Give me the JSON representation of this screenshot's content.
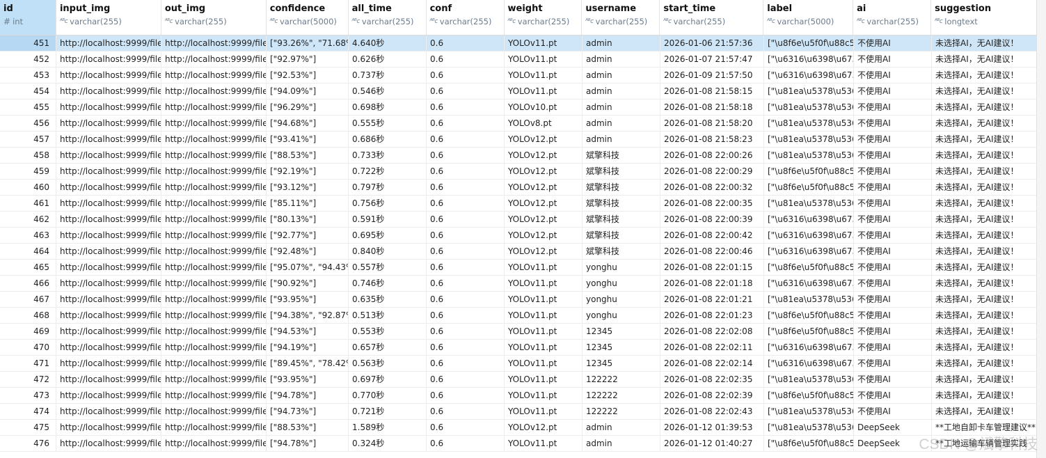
{
  "columns": [
    {
      "name": "id",
      "type": "int",
      "kind": "num"
    },
    {
      "name": "input_img",
      "type": "varchar(255)",
      "kind": "text"
    },
    {
      "name": "out_img",
      "type": "varchar(255)",
      "kind": "text"
    },
    {
      "name": "confidence",
      "type": "varchar(5000)",
      "kind": "text"
    },
    {
      "name": "all_time",
      "type": "varchar(255)",
      "kind": "text"
    },
    {
      "name": "conf",
      "type": "varchar(255)",
      "kind": "text"
    },
    {
      "name": "weight",
      "type": "varchar(255)",
      "kind": "text"
    },
    {
      "name": "username",
      "type": "varchar(255)",
      "kind": "text"
    },
    {
      "name": "start_time",
      "type": "varchar(255)",
      "kind": "text"
    },
    {
      "name": "label",
      "type": "varchar(5000)",
      "kind": "text"
    },
    {
      "name": "ai",
      "type": "varchar(255)",
      "kind": "text"
    },
    {
      "name": "suggestion",
      "type": "longtext",
      "kind": "text"
    }
  ],
  "type_prefix": "ᴬᴮc",
  "rows": [
    [
      "451",
      "http://localhost:9999/file",
      "http://localhost:9999/file",
      "[\"93.26%\", \"71.68%",
      "4.640秒",
      "0.6",
      "YOLOv11.pt",
      "admin",
      "2026-01-06 21:57:36",
      "[\"\\u8f6e\\u5f0f\\u88c5",
      "不使用AI",
      "未选择AI，无AI建议！"
    ],
    [
      "452",
      "http://localhost:9999/file",
      "http://localhost:9999/file",
      "[\"92.97%\"]",
      "0.626秒",
      "0.6",
      "YOLOv11.pt",
      "admin",
      "2026-01-07 21:57:47",
      "[\"\\u6316\\u6398\\u673",
      "不使用AI",
      "未选择AI，无AI建议！"
    ],
    [
      "453",
      "http://localhost:9999/file",
      "http://localhost:9999/file",
      "[\"92.53%\"]",
      "0.737秒",
      "0.6",
      "YOLOv11.pt",
      "admin",
      "2026-01-09 21:57:50",
      "[\"\\u6316\\u6398\\u673",
      "不使用AI",
      "未选择AI，无AI建议！"
    ],
    [
      "454",
      "http://localhost:9999/file",
      "http://localhost:9999/file",
      "[\"94.09%\"]",
      "0.546秒",
      "0.6",
      "YOLOv11.pt",
      "admin",
      "2026-01-08 21:58:15",
      "[\"\\u81ea\\u5378\\u536",
      "不使用AI",
      "未选择AI，无AI建议！"
    ],
    [
      "455",
      "http://localhost:9999/file",
      "http://localhost:9999/file",
      "[\"96.29%\"]",
      "0.698秒",
      "0.6",
      "YOLOv10.pt",
      "admin",
      "2026-01-08 21:58:18",
      "[\"\\u81ea\\u5378\\u536",
      "不使用AI",
      "未选择AI，无AI建议！"
    ],
    [
      "456",
      "http://localhost:9999/file",
      "http://localhost:9999/file",
      "[\"94.68%\"]",
      "0.555秒",
      "0.6",
      "YOLOv8.pt",
      "admin",
      "2026-01-08 21:58:20",
      "[\"\\u81ea\\u5378\\u536",
      "不使用AI",
      "未选择AI，无AI建议！"
    ],
    [
      "457",
      "http://localhost:9999/file",
      "http://localhost:9999/file",
      "[\"93.41%\"]",
      "0.686秒",
      "0.6",
      "YOLOv12.pt",
      "admin",
      "2026-01-08 21:58:23",
      "[\"\\u81ea\\u5378\\u536",
      "不使用AI",
      "未选择AI，无AI建议！"
    ],
    [
      "458",
      "http://localhost:9999/file",
      "http://localhost:9999/file",
      "[\"88.53%\"]",
      "0.733秒",
      "0.6",
      "YOLOv12.pt",
      "斌擎科技",
      "2026-01-08 22:00:26",
      "[\"\\u81ea\\u5378\\u536",
      "不使用AI",
      "未选择AI，无AI建议！"
    ],
    [
      "459",
      "http://localhost:9999/file",
      "http://localhost:9999/file",
      "[\"92.19%\"]",
      "0.722秒",
      "0.6",
      "YOLOv12.pt",
      "斌擎科技",
      "2026-01-08 22:00:29",
      "[\"\\u8f6e\\u5f0f\\u88c5",
      "不使用AI",
      "未选择AI，无AI建议！"
    ],
    [
      "460",
      "http://localhost:9999/file",
      "http://localhost:9999/file",
      "[\"93.12%\"]",
      "0.797秒",
      "0.6",
      "YOLOv12.pt",
      "斌擎科技",
      "2026-01-08 22:00:32",
      "[\"\\u8f6e\\u5f0f\\u88c5",
      "不使用AI",
      "未选择AI，无AI建议！"
    ],
    [
      "461",
      "http://localhost:9999/file",
      "http://localhost:9999/file",
      "[\"85.11%\"]",
      "0.756秒",
      "0.6",
      "YOLOv12.pt",
      "斌擎科技",
      "2026-01-08 22:00:35",
      "[\"\\u81ea\\u5378\\u536",
      "不使用AI",
      "未选择AI，无AI建议！"
    ],
    [
      "462",
      "http://localhost:9999/file",
      "http://localhost:9999/file",
      "[\"80.13%\"]",
      "0.591秒",
      "0.6",
      "YOLOv12.pt",
      "斌擎科技",
      "2026-01-08 22:00:39",
      "[\"\\u6316\\u6398\\u673",
      "不使用AI",
      "未选择AI，无AI建议！"
    ],
    [
      "463",
      "http://localhost:9999/file",
      "http://localhost:9999/file",
      "[\"92.77%\"]",
      "0.695秒",
      "0.6",
      "YOLOv12.pt",
      "斌擎科技",
      "2026-01-08 22:00:42",
      "[\"\\u6316\\u6398\\u673",
      "不使用AI",
      "未选择AI，无AI建议！"
    ],
    [
      "464",
      "http://localhost:9999/file",
      "http://localhost:9999/file",
      "[\"92.48%\"]",
      "0.840秒",
      "0.6",
      "YOLOv12.pt",
      "斌擎科技",
      "2026-01-08 22:00:46",
      "[\"\\u6316\\u6398\\u673",
      "不使用AI",
      "未选择AI，无AI建议！"
    ],
    [
      "465",
      "http://localhost:9999/file",
      "http://localhost:9999/file",
      "[\"95.07%\", \"94.43%",
      "0.557秒",
      "0.6",
      "YOLOv11.pt",
      "yonghu",
      "2026-01-08 22:01:15",
      "[\"\\u8f6e\\u5f0f\\u88c5",
      "不使用AI",
      "未选择AI，无AI建议！"
    ],
    [
      "466",
      "http://localhost:9999/file",
      "http://localhost:9999/file",
      "[\"90.92%\"]",
      "0.746秒",
      "0.6",
      "YOLOv11.pt",
      "yonghu",
      "2026-01-08 22:01:18",
      "[\"\\u6316\\u6398\\u673",
      "不使用AI",
      "未选择AI，无AI建议！"
    ],
    [
      "467",
      "http://localhost:9999/file",
      "http://localhost:9999/file",
      "[\"93.95%\"]",
      "0.635秒",
      "0.6",
      "YOLOv11.pt",
      "yonghu",
      "2026-01-08 22:01:21",
      "[\"\\u81ea\\u5378\\u536",
      "不使用AI",
      "未选择AI，无AI建议！"
    ],
    [
      "468",
      "http://localhost:9999/file",
      "http://localhost:9999/file",
      "[\"94.38%\", \"92.87%",
      "0.513秒",
      "0.6",
      "YOLOv11.pt",
      "yonghu",
      "2026-01-08 22:01:23",
      "[\"\\u8f6e\\u5f0f\\u88c5",
      "不使用AI",
      "未选择AI，无AI建议！"
    ],
    [
      "469",
      "http://localhost:9999/file",
      "http://localhost:9999/file",
      "[\"94.53%\"]",
      "0.553秒",
      "0.6",
      "YOLOv11.pt",
      "12345",
      "2026-01-08 22:02:08",
      "[\"\\u8f6e\\u5f0f\\u88c5",
      "不使用AI",
      "未选择AI，无AI建议！"
    ],
    [
      "470",
      "http://localhost:9999/file",
      "http://localhost:9999/file",
      "[\"94.19%\"]",
      "0.657秒",
      "0.6",
      "YOLOv11.pt",
      "12345",
      "2026-01-08 22:02:11",
      "[\"\\u6316\\u6398\\u673",
      "不使用AI",
      "未选择AI，无AI建议！"
    ],
    [
      "471",
      "http://localhost:9999/file",
      "http://localhost:9999/file",
      "[\"89.45%\", \"78.42%",
      "0.563秒",
      "0.6",
      "YOLOv11.pt",
      "12345",
      "2026-01-08 22:02:14",
      "[\"\\u6316\\u6398\\u673",
      "不使用AI",
      "未选择AI，无AI建议！"
    ],
    [
      "472",
      "http://localhost:9999/file",
      "http://localhost:9999/file",
      "[\"93.95%\"]",
      "0.697秒",
      "0.6",
      "YOLOv11.pt",
      "122222",
      "2026-01-08 22:02:35",
      "[\"\\u81ea\\u5378\\u536",
      "不使用AI",
      "未选择AI，无AI建议！"
    ],
    [
      "473",
      "http://localhost:9999/file",
      "http://localhost:9999/file",
      "[\"94.78%\"]",
      "0.770秒",
      "0.6",
      "YOLOv11.pt",
      "122222",
      "2026-01-08 22:02:39",
      "[\"\\u8f6e\\u5f0f\\u88c5",
      "不使用AI",
      "未选择AI，无AI建议！"
    ],
    [
      "474",
      "http://localhost:9999/file",
      "http://localhost:9999/file",
      "[\"94.73%\"]",
      "0.721秒",
      "0.6",
      "YOLOv11.pt",
      "122222",
      "2026-01-08 22:02:43",
      "[\"\\u81ea\\u5378\\u536",
      "不使用AI",
      "未选择AI，无AI建议！"
    ],
    [
      "475",
      "http://localhost:9999/file",
      "http://localhost:9999/file",
      "[\"88.53%\"]",
      "1.589秒",
      "0.6",
      "YOLOv12.pt",
      "admin",
      "2026-01-12 01:39:53",
      "[\"\\u81ea\\u5378\\u536",
      "DeepSeek",
      "**工地自卸卡车管理建议**"
    ],
    [
      "476",
      "http://localhost:9999/file",
      "http://localhost:9999/file",
      "[\"94.78%\"]",
      "0.324秒",
      "0.6",
      "YOLOv11.pt",
      "admin",
      "2026-01-12 01:40:27",
      "[\"\\u8f6e\\u5f0f\\u88c5",
      "DeepSeek",
      "**工地运输车辆管理实践"
    ]
  ],
  "selected_row": 0,
  "watermark": "CSDN @斌擎科技",
  "colors": {
    "selected_header": "#bfe0f7",
    "selected_row": "#cfe6f8",
    "type_text": "#6b7b8c"
  }
}
